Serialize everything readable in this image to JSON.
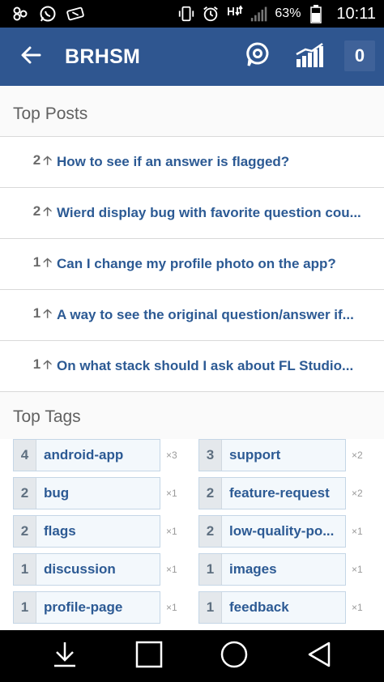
{
  "status_bar": {
    "battery_pct": "63%",
    "time": "10:11",
    "icons": [
      "app-icon",
      "whatsapp-icon",
      "ticket-icon",
      "vibrate-icon",
      "alarm-icon",
      "data-icon",
      "signal-icon",
      "battery-icon"
    ]
  },
  "app_bar": {
    "title": "BRHSM",
    "badge": "0",
    "icons": [
      "back-arrow-icon",
      "location-icon",
      "stats-chart-icon"
    ]
  },
  "top_posts": {
    "header": "Top Posts",
    "items": [
      {
        "score": "2",
        "title": "How to see if an answer is flagged?"
      },
      {
        "score": "2",
        "title": "Wierd display bug with favorite question cou..."
      },
      {
        "score": "1",
        "title": "Can I change my profile photo on the app?"
      },
      {
        "score": "1",
        "title": "A way to see the original question/answer if..."
      },
      {
        "score": "1",
        "title": "On what stack should I ask about FL Studio..."
      }
    ]
  },
  "top_tags": {
    "header": "Top Tags",
    "items": [
      {
        "count": "4",
        "name": "android-app",
        "mult": "×3"
      },
      {
        "count": "3",
        "name": "support",
        "mult": "×2"
      },
      {
        "count": "2",
        "name": "bug",
        "mult": "×1"
      },
      {
        "count": "2",
        "name": "feature-request",
        "mult": "×2"
      },
      {
        "count": "2",
        "name": "flags",
        "mult": "×1"
      },
      {
        "count": "2",
        "name": "low-quality-po...",
        "mult": "×1"
      },
      {
        "count": "1",
        "name": "discussion",
        "mult": "×1"
      },
      {
        "count": "1",
        "name": "images",
        "mult": "×1"
      },
      {
        "count": "1",
        "name": "profile-page",
        "mult": "×1"
      },
      {
        "count": "1",
        "name": "feedback",
        "mult": "×1"
      }
    ]
  },
  "nav_bar": {
    "icons": [
      "download-icon",
      "recents-square-icon",
      "home-circle-icon",
      "back-triangle-icon"
    ]
  },
  "colors": {
    "app_bar": "#2f5690",
    "link": "#2c5a94",
    "status_bar": "#000000"
  }
}
